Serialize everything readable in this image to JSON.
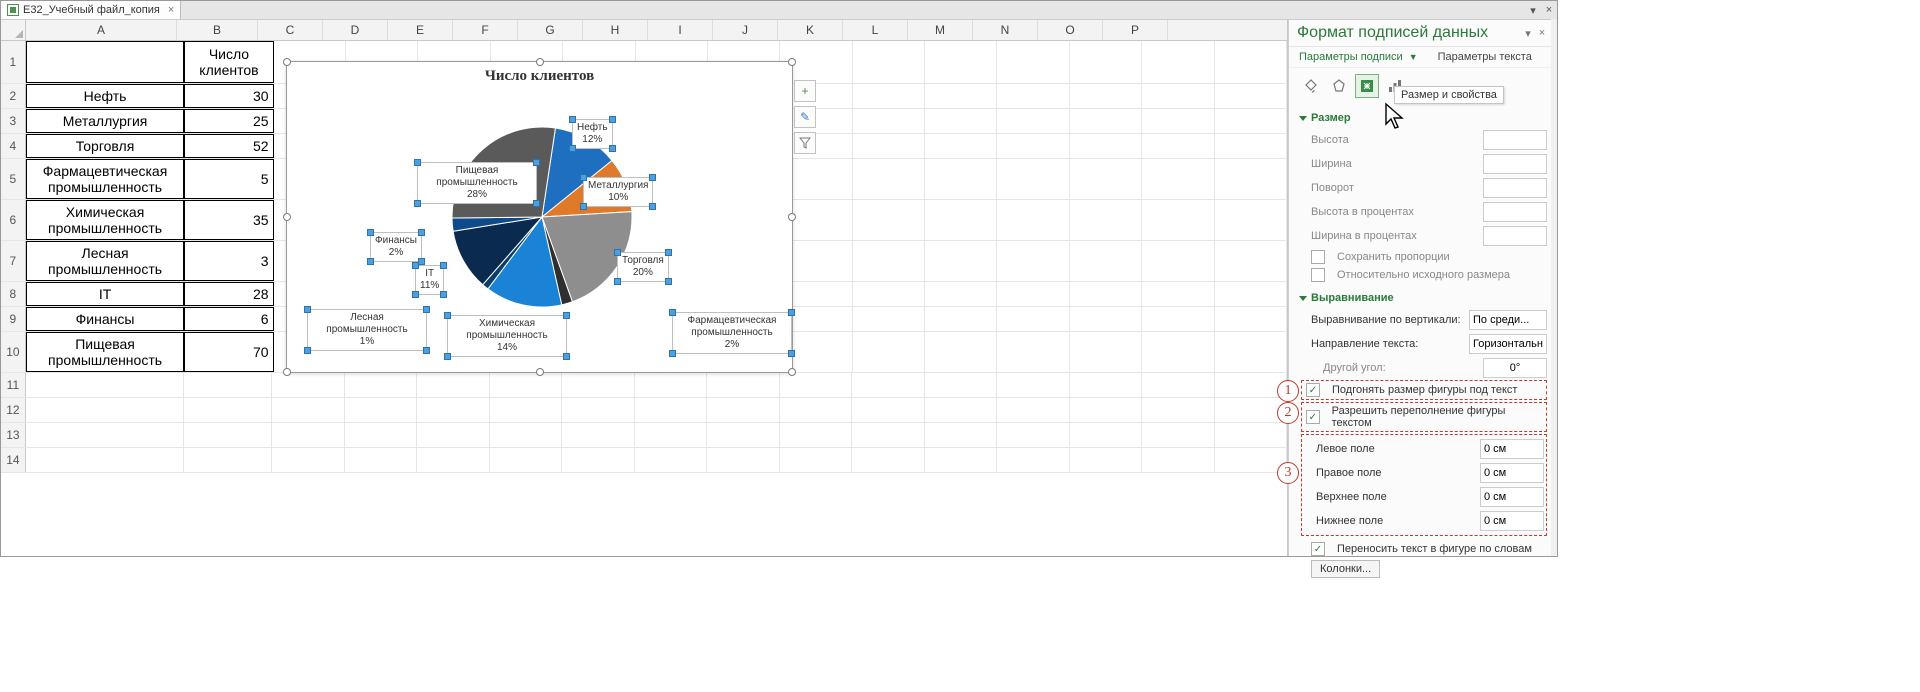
{
  "file_tab": "E32_Учебный файл_копия",
  "columns": [
    "A",
    "B",
    "C",
    "D",
    "E",
    "F",
    "G",
    "H",
    "I",
    "J",
    "K",
    "L",
    "M",
    "N",
    "O",
    "P"
  ],
  "col_widths": {
    "A": 150,
    "B": 80
  },
  "header_row": {
    "A": "",
    "B": "Число клиентов"
  },
  "rows": [
    {
      "n": "1",
      "A": "",
      "B": ""
    },
    {
      "n": "2",
      "A": "Нефть",
      "B": "30"
    },
    {
      "n": "3",
      "A": "Металлургия",
      "B": "25"
    },
    {
      "n": "4",
      "A": "Торговля",
      "B": "52"
    },
    {
      "n": "5",
      "A": "Фармацевтическая промышленность",
      "B": "5"
    },
    {
      "n": "6",
      "A": "Химическая промышленность",
      "B": "35"
    },
    {
      "n": "7",
      "A": "Лесная промышленность",
      "B": "3"
    },
    {
      "n": "8",
      "A": "IT",
      "B": "28"
    },
    {
      "n": "9",
      "A": "Финансы",
      "B": "6"
    },
    {
      "n": "10",
      "A": "Пищевая промышленность",
      "B": "70"
    },
    {
      "n": "11",
      "A": "",
      "B": ""
    },
    {
      "n": "12",
      "A": "",
      "B": ""
    },
    {
      "n": "13",
      "A": "",
      "B": ""
    },
    {
      "n": "14",
      "A": "",
      "B": ""
    }
  ],
  "chart_data": {
    "type": "pie",
    "title": "Число клиентов",
    "categories": [
      "Нефть",
      "Металлургия",
      "Торговля",
      "Фармацевтическая промышленность",
      "Химическая промышленность",
      "Лесная промышленность",
      "IT",
      "Финансы",
      "Пищевая промышленность"
    ],
    "values": [
      30,
      25,
      52,
      5,
      35,
      3,
      28,
      6,
      70
    ],
    "labels_percent": [
      "12%",
      "10%",
      "20%",
      "2%",
      "14%",
      "1%",
      "11%",
      "2%",
      "28%"
    ],
    "colors": [
      "#1f6fc0",
      "#e07a2b",
      "#8e8e8e",
      "#2f2f2f",
      "#1b83d6",
      "#0b3d6b",
      "#0b2a50",
      "#0f4a8a",
      "#5a5a5a"
    ]
  },
  "chart_buttons": {
    "plus": "+",
    "brush": "✎",
    "filter": "⎄"
  },
  "pane": {
    "title": "Формат подписей данных",
    "tab1": "Параметры подписи",
    "tab2": "Параметры текста",
    "tooltip": "Размер и свойства",
    "section_size": "Размер",
    "size_fields": {
      "height": "Высота",
      "width": "Ширина",
      "rotate": "Поворот",
      "height_pct": "Высота в процентах",
      "width_pct": "Ширина в процентах",
      "keep_ratio": "Сохранить пропорции",
      "relative": "Относительно исходного размера"
    },
    "section_align": "Выравнивание",
    "align_fields": {
      "valign_lbl": "Выравнивание по вертикали:",
      "valign_val": "По среди...",
      "dir_lbl": "Направление текста:",
      "dir_val": "Горизонтально",
      "angle_lbl": "Другой угол:",
      "angle_val": "0°",
      "fit_text": "Подгонять размер фигуры под текст",
      "overflow": "Разрешить переполнение фигуры текстом",
      "left": "Левое поле",
      "right": "Правое поле",
      "top": "Верхнее поле",
      "bottom": "Нижнее поле",
      "margin_val": "0 см",
      "wrap": "Переносить текст в фигуре по словам",
      "cols_btn": "Колонки..."
    },
    "markers": [
      "1",
      "2",
      "3"
    ]
  }
}
